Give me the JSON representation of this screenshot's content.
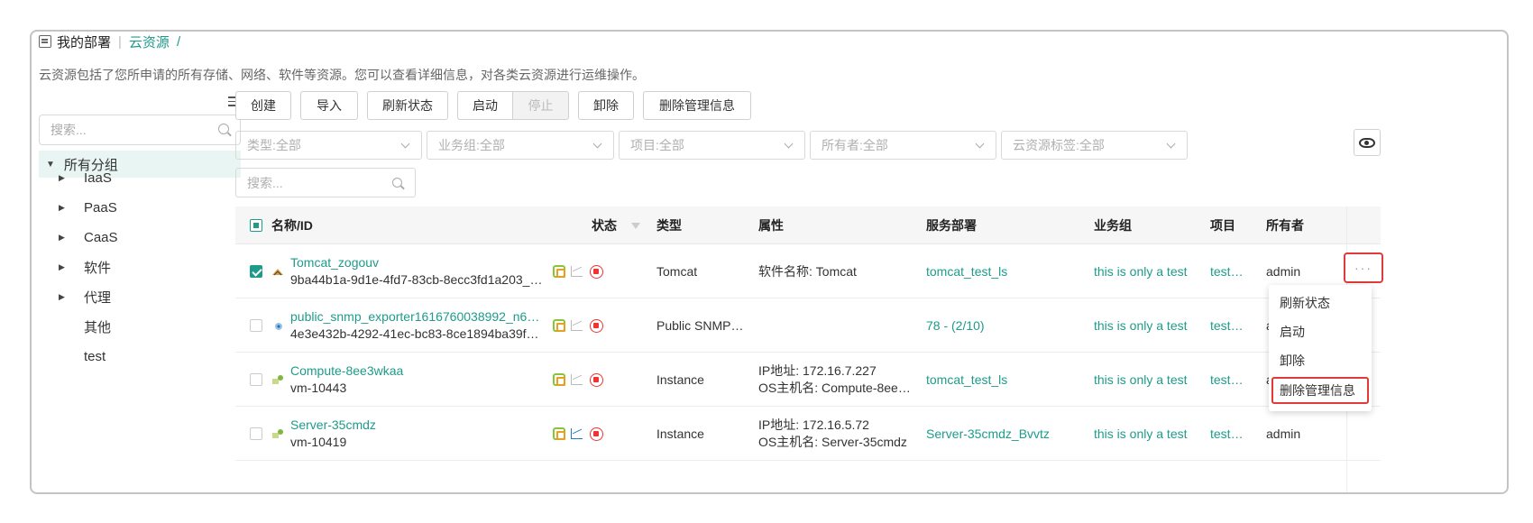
{
  "breadcrumb": {
    "root": "我的部署",
    "current": "云资源",
    "trailing": "/"
  },
  "description": "云资源包括了您所申请的所有存储、网络、软件等资源。您可以查看详细信息，对各类云资源进行运维操作。",
  "tree": {
    "search_placeholder": "搜索...",
    "root_label": "所有分组",
    "groups": [
      "IaaS",
      "PaaS",
      "CaaS",
      "软件",
      "代理"
    ],
    "leaves": [
      "其他",
      "test"
    ]
  },
  "toolbar": {
    "create": "创建",
    "import": "导入",
    "refresh": "刷新状态",
    "start": "启动",
    "stop": "停止",
    "unload": "卸除",
    "delete_mgmt": "删除管理信息"
  },
  "filters": {
    "type": "类型:全部",
    "business_group": "业务组:全部",
    "project": "项目:全部",
    "owner": "所有者:全部",
    "tag": "云资源标签:全部",
    "search_placeholder": "搜索..."
  },
  "table": {
    "headers": {
      "name": "名称/ID",
      "status": "状态",
      "type": "类型",
      "attributes": "属性",
      "deployment": "服务部署",
      "business_group": "业务组",
      "project": "项目",
      "owner": "所有者"
    },
    "rows": [
      {
        "name": "Tomcat_zogouv",
        "id": "9ba44b1a-9d1e-4fd7-83cb-8ecc3fd1a203_…",
        "type": "Tomcat",
        "attr1": "软件名称: Tomcat",
        "attr2": "",
        "deployment": "tomcat_test_ls",
        "business_group": "this is only a test",
        "project": "test…",
        "owner": "admin",
        "checked": true
      },
      {
        "name": "public_snmp_exporter1616760038992_n6…",
        "id": "4e3e432b-4292-41ec-bc83-8ce1894ba39f…",
        "type": "Public SNMP…",
        "attr1": "",
        "attr2": "",
        "deployment": "78 - (2/10)",
        "business_group": "this is only a test",
        "project": "test…",
        "owner": "a",
        "checked": false
      },
      {
        "name": "Compute-8ee3wkaa",
        "id": "vm-10443",
        "type": "Instance",
        "attr1": "IP地址: 172.16.7.227",
        "attr2": "OS主机名: Compute-8ee…",
        "deployment": "tomcat_test_ls",
        "business_group": "this is only a test",
        "project": "test…",
        "owner": "a",
        "checked": false
      },
      {
        "name": "Server-35cmdz",
        "id": "vm-10419",
        "type": "Instance",
        "attr1": "IP地址: 172.16.5.72",
        "attr2": "OS主机名: Server-35cmdz",
        "deployment": "Server-35cmdz_Bvvtz",
        "business_group": "this is only a test",
        "project": "test…",
        "owner": "admin",
        "checked": false
      }
    ]
  },
  "row_menu": {
    "ellipsis": "···",
    "items": [
      "刷新状态",
      "启动",
      "卸除",
      "删除管理信息"
    ]
  }
}
